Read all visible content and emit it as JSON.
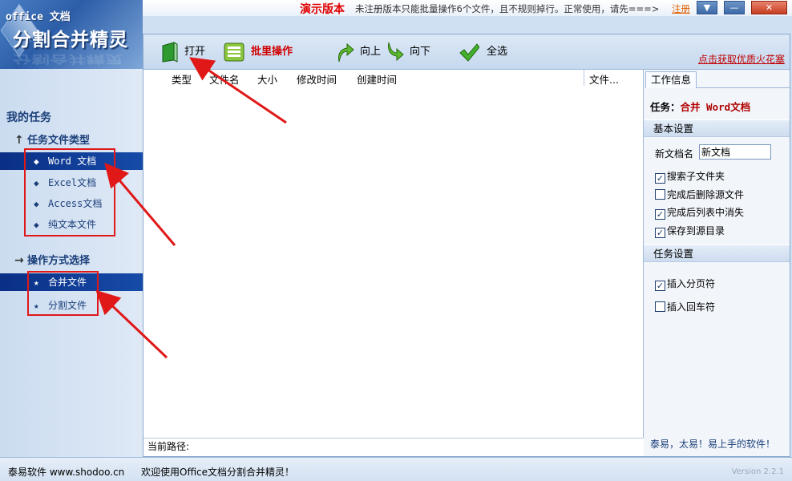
{
  "app": {
    "logo_subtitle": "office 文档",
    "logo_title": "分割合并精灵",
    "demo_label": "演示版本",
    "notice": "未注册版本只能批量操作6个文件，且不规则掉行。正常使用，请先===>",
    "register": "注册"
  },
  "sidebar": {
    "my_tasks": "我的任务",
    "file_types_header": "任务文件类型",
    "file_types": [
      {
        "label": "Word 文档",
        "selected": true
      },
      {
        "label": "Excel文档",
        "selected": false
      },
      {
        "label": "Access文档",
        "selected": false
      },
      {
        "label": "纯文本文件",
        "selected": false
      }
    ],
    "operation_header": "操作方式选择",
    "operations": [
      {
        "label": "合并文件",
        "selected": true
      },
      {
        "label": "分割文件",
        "selected": false
      }
    ]
  },
  "toolbar": {
    "open": "打开",
    "batch": "批里操作",
    "up": "向上",
    "down": "向下",
    "select_all": "全选",
    "promo_link": "点击获取优质火花塞"
  },
  "filelist": {
    "columns": [
      "类型",
      "文件名",
      "大小",
      "修改时间",
      "创建时间",
      "文件..."
    ],
    "current_path_label": "当前路径:"
  },
  "right_panel": {
    "tab": "工作信息",
    "task_label": "任务：",
    "task_value": "合并 Word文档",
    "basic_settings": "基本设置",
    "new_doc_name_label": "新文档名",
    "new_doc_name_value": "新文档",
    "checks_basic": [
      {
        "label": "搜索子文件夹",
        "checked": true
      },
      {
        "label": "完成后删除源文件",
        "checked": false
      },
      {
        "label": "完成后列表中消失",
        "checked": true
      },
      {
        "label": "保存到源目录",
        "checked": true
      }
    ],
    "task_settings": "任务设置",
    "checks_task": [
      {
        "label": "插入分页符",
        "checked": true
      },
      {
        "label": "插入回车符",
        "checked": false
      }
    ],
    "slogan": "泰易，太易！易上手的软件！"
  },
  "statusbar": {
    "left": "泰易软件 www.shodoo.cn",
    "welcome": "欢迎使用Office文档分割合并精灵！",
    "version": "Version 2.2.1"
  },
  "colors": {
    "accent_red": "#e00000",
    "selection_blue": "#0a2f85",
    "annotation_red": "#e01818"
  }
}
